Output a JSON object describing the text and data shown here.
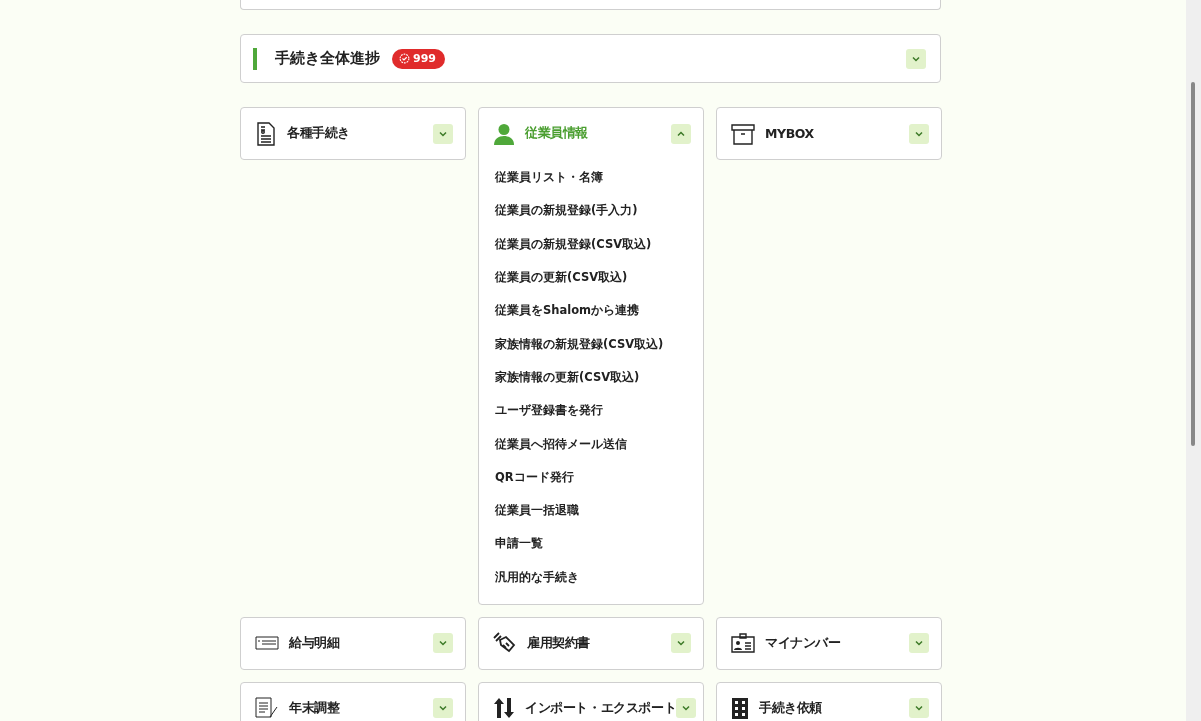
{
  "progress": {
    "title": "手続き全体進捗",
    "badge": "999",
    "expanded": false
  },
  "tiles": [
    {
      "kind": "document",
      "label": "各種手続き",
      "expanded": false
    },
    {
      "kind": "person",
      "label": "従業員情報",
      "expanded": true,
      "items": [
        "従業員リスト・名簿",
        "従業員の新規登録(手入力)",
        "従業員の新規登録(CSV取込)",
        "従業員の更新(CSV取込)",
        "従業員をShalomから連携",
        "家族情報の新規登録(CSV取込)",
        "家族情報の更新(CSV取込)",
        "ユーザ登録書を発行",
        "従業員へ招待メール送信",
        "QRコード発行",
        "従業員一括退職",
        "申請一覧",
        "汎用的な手続き"
      ]
    },
    {
      "kind": "box",
      "label": "MYBOX",
      "expanded": false
    },
    {
      "kind": "payslip",
      "label": "給与明細",
      "expanded": false
    },
    {
      "kind": "handshake",
      "label": "雇用契約書",
      "expanded": false
    },
    {
      "kind": "idcard",
      "label": "マイナンバー",
      "expanded": false
    },
    {
      "kind": "form",
      "label": "年末調整",
      "expanded": false
    },
    {
      "kind": "arrows",
      "label": "インポート・エクスポート",
      "expanded": false
    },
    {
      "kind": "building",
      "label": "手続き依頼",
      "expanded": false
    }
  ]
}
